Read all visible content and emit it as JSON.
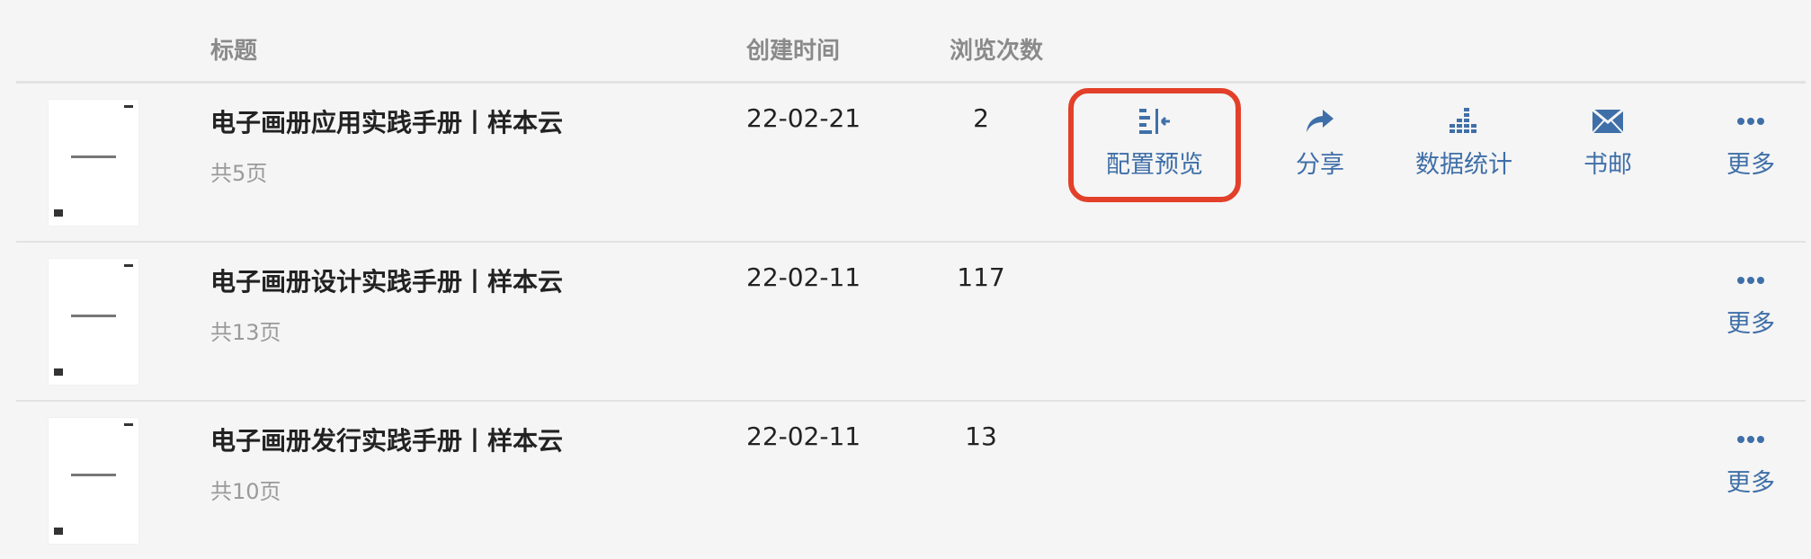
{
  "header": {
    "title_col": "标题",
    "created_col": "创建时间",
    "views_col": "浏览次数"
  },
  "rows": [
    {
      "title": "电子画册应用实践手册丨样本云",
      "pages": "共5页",
      "date": "22-02-21",
      "views": "2"
    },
    {
      "title": "电子画册设计实践手册丨样本云",
      "pages": "共13页",
      "date": "22-02-11",
      "views": "117"
    },
    {
      "title": "电子画册发行实践手册丨样本云",
      "pages": "共10页",
      "date": "22-02-11",
      "views": "13"
    }
  ],
  "actions": {
    "preview": "配置预览",
    "share": "分享",
    "stats": "数据统计",
    "mail": "书邮",
    "more": "更多"
  },
  "colors": {
    "accent": "#3f6fa8",
    "highlight": "#e2402a"
  },
  "icons": {
    "preview": "bar-config-icon",
    "share": "share-arrow-icon",
    "stats": "bar-chart-icon",
    "mail": "envelope-icon",
    "more": "ellipsis-icon"
  }
}
